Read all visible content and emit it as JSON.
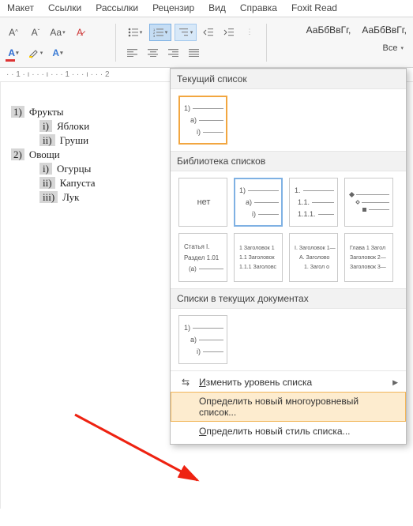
{
  "ribbon_tabs": [
    "Макет",
    "Ссылки",
    "Рассылки",
    "Рецензир",
    "Вид",
    "Справка",
    "Foxit Read"
  ],
  "styles": {
    "sample1": "АаБбВвГг,",
    "sample2": "АаБбВвГг,",
    "all": "Все"
  },
  "ruler_text": "· · 1 · ı · · · ı · · · 1 · · · ı · · · 2",
  "doc": {
    "items": [
      {
        "num": "1)",
        "text": "Фрукты",
        "children": [
          {
            "num": "i)",
            "text": "Яблоки"
          },
          {
            "num": "ii)",
            "text": "Груши"
          }
        ]
      },
      {
        "num": "2)",
        "text": "Овощи",
        "children": [
          {
            "num": "i)",
            "text": "Огурцы"
          },
          {
            "num": "ii)",
            "text": "Капуста"
          },
          {
            "num": "iii)",
            "text": "Лук"
          }
        ]
      }
    ]
  },
  "panel": {
    "section_current": "Текущий список",
    "section_library": "Библиотека списков",
    "section_docs": "Списки в текущих документах",
    "none_label": "нет",
    "tiles": {
      "current": [
        {
          "l1": "1)",
          "l2": "a)",
          "l3": "i)"
        }
      ],
      "library": [
        {
          "none": true
        },
        {
          "l1": "1)",
          "l2": "a)",
          "l3": "i)",
          "highlight": true
        },
        {
          "l1": "1.",
          "l2": "1.1.",
          "l3": "1.1.1."
        },
        {
          "bullets": true
        },
        {
          "l1": "Статья I.",
          "l2": "Раздел 1.01",
          "l3": "(a)"
        },
        {
          "l1": "1 Заголовок 1",
          "l2": "1.1 Заголовок",
          "l3": "1.1.1 Заголовс"
        },
        {
          "l1": "I. Заголовок 1—",
          "l2": "A. Заголово",
          "l3": "1. Загол о"
        },
        {
          "l1": "Глава 1 Загол",
          "l2": "Заголовок 2—",
          "l3": "Заголовок 3—"
        }
      ],
      "docs": [
        {
          "l1": "1)",
          "l2": "a)",
          "l3": "i)"
        }
      ]
    },
    "footer": {
      "change_level": "Изменить уровень списка",
      "define_multilevel": "Определить новый многоуровневый список...",
      "define_style": "Определить новый стиль списка..."
    }
  }
}
